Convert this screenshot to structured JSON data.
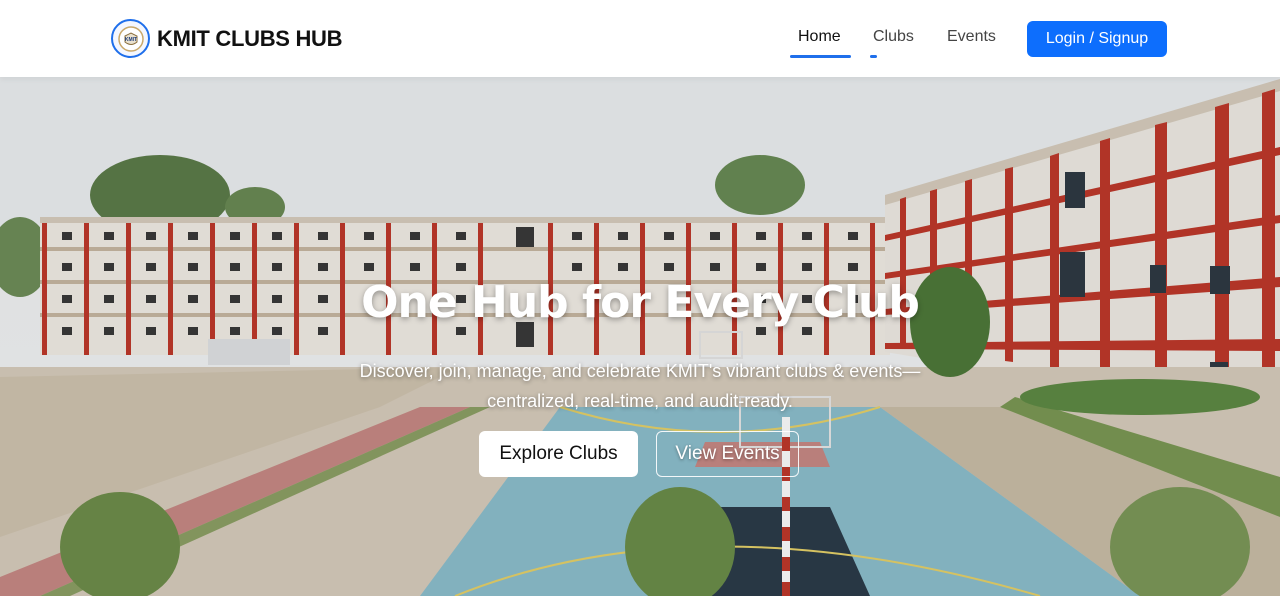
{
  "brand": {
    "name": "KMIT CLUBS HUB",
    "logo_icon": "kmit-logo-icon"
  },
  "nav": {
    "links": [
      {
        "label": "Home",
        "active": true
      },
      {
        "label": "Clubs",
        "active": false
      },
      {
        "label": "Events",
        "active": false
      }
    ],
    "login_label": "Login / Signup"
  },
  "hero": {
    "title": "One Hub for Every Club",
    "subtitle": "Discover, join, manage, and celebrate KMIT's vibrant clubs & events—centralized, real-time, and audit-ready.",
    "primary_button": "Explore Clubs",
    "secondary_button": "View Events"
  },
  "colors": {
    "accent": "#0d6efd",
    "building_red": "#c0392b",
    "court_blue": "#7fb3c4"
  }
}
